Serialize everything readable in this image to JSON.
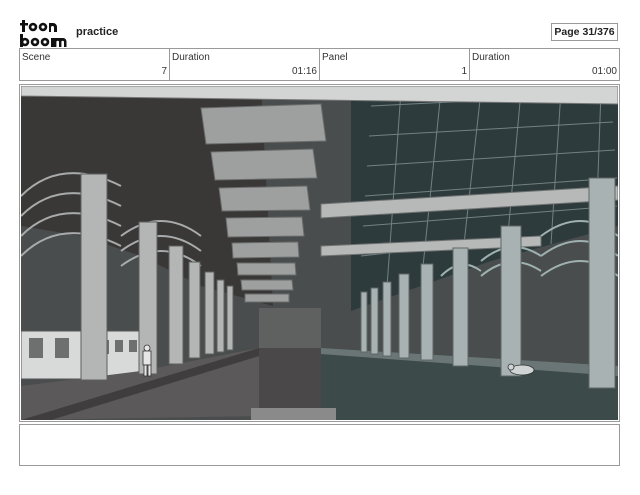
{
  "header": {
    "logo_text": "toon boom",
    "project_title": "practice",
    "page_label": "Page",
    "page_value": "31/376"
  },
  "info": [
    {
      "label": "Scene",
      "value": "7"
    },
    {
      "label": "Duration",
      "value": "01:16"
    },
    {
      "label": "Panel",
      "value": "1"
    },
    {
      "label": "Duration",
      "value": "01:00"
    }
  ],
  "panel": {
    "image": "subway-station-platform-sketch",
    "notes": ""
  }
}
